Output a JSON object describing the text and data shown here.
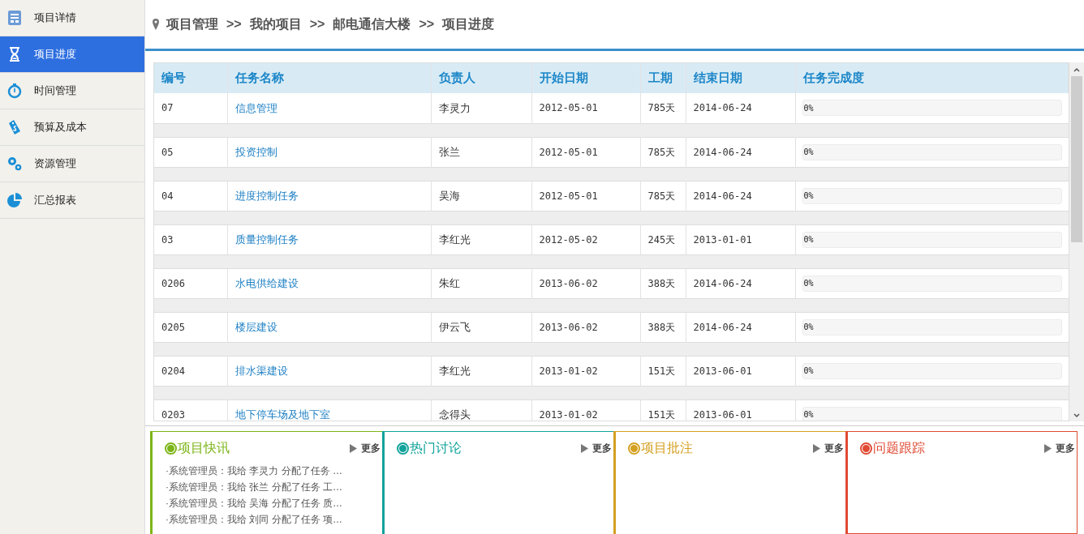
{
  "sidebar": {
    "items": [
      {
        "label": "项目详情",
        "selected": false
      },
      {
        "label": "项目进度",
        "selected": true
      },
      {
        "label": "时间管理",
        "selected": false
      },
      {
        "label": "预算及成本",
        "selected": false
      },
      {
        "label": "资源管理",
        "selected": false
      },
      {
        "label": "汇总报表",
        "selected": false
      }
    ]
  },
  "breadcrumb": [
    "项目管理",
    "我的项目",
    "邮电通信大楼",
    "项目进度"
  ],
  "breadcrumb_separator": ">>",
  "table": {
    "columns": [
      "编号",
      "任务名称",
      "负责人",
      "开始日期",
      "工期",
      "结束日期",
      "任务完成度"
    ],
    "rows": [
      {
        "id": "07",
        "name": "信息管理",
        "owner": "李灵力",
        "start": "2012-05-01",
        "duration": "785天",
        "end": "2014-06-24",
        "level": 0,
        "reading": "0%"
      },
      {
        "id": "05",
        "name": "投资控制",
        "owner": "张兰",
        "start": "2012-05-01",
        "duration": "785天",
        "end": "2014-06-24",
        "level": 0,
        "reading": "0%"
      },
      {
        "id": "04",
        "name": "进度控制任务",
        "owner": "吴海",
        "start": "2012-05-01",
        "duration": "785天",
        "end": "2014-06-24",
        "level": 0,
        "reading": "0%"
      },
      {
        "id": "03",
        "name": "质量控制任务",
        "owner": "李红光",
        "start": "2012-05-02",
        "duration": "245天",
        "end": "2013-01-01",
        "level": 0,
        "reading": "0%"
      },
      {
        "id": "0206",
        "name": "水电供给建设",
        "owner": "朱红",
        "start": "2013-06-02",
        "duration": "388天",
        "end": "2014-06-24",
        "level": 0,
        "reading": "0%"
      },
      {
        "id": "0205",
        "name": "楼层建设",
        "owner": "伊云飞",
        "start": "2013-06-02",
        "duration": "388天",
        "end": "2014-06-24",
        "level": 0,
        "reading": "0%"
      },
      {
        "id": "0204",
        "name": "排水渠建设",
        "owner": "李红光",
        "start": "2013-01-02",
        "duration": "151天",
        "end": "2013-06-01",
        "level": 0,
        "reading": "0%"
      },
      {
        "id": "0203",
        "name": "地下停车场及地下室",
        "owner": "念得头",
        "start": "2013-01-02",
        "duration": "151天",
        "end": "2013-06-01",
        "level": 0,
        "reading": "0%"
      }
    ]
  },
  "panels": [
    {
      "title": "项目快讯",
      "color": "#7cb518",
      "more": "更多",
      "items": [
        "·系统管理员：我给 李灵力 分配了任务 …",
        "·系统管理员：我给 张兰 分配了任务 工…",
        "·系统管理员：我给 吴海 分配了任务 质…",
        "·系统管理员：我给 刘同 分配了任务 项…"
      ]
    },
    {
      "title": "热门讨论",
      "color": "#11a29b",
      "more": "更多"
    },
    {
      "title": "项目批注",
      "color": "#d4a021",
      "more": "更多"
    },
    {
      "title": "问题跟踪",
      "color": "#e04a33",
      "more": "更多"
    }
  ]
}
